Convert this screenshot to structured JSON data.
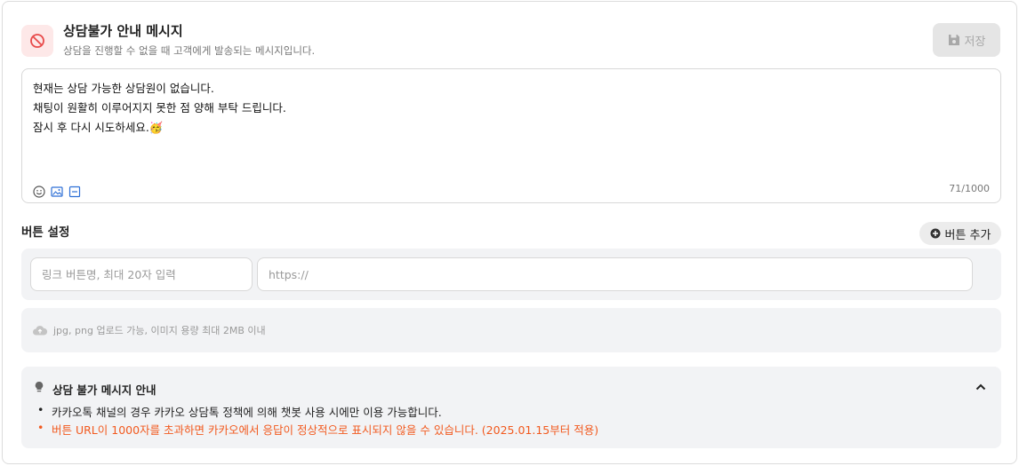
{
  "header": {
    "title": "상담불가 안내 메시지",
    "subtitle": "상담을 진행할 수 없을 때 고객에게 발송되는 메시지입니다.",
    "save_label": "저장"
  },
  "message": {
    "lines": [
      "현재는 상담 가능한 상담원이 없습니다.",
      "채팅이 원활히 이루어지지 못한 점 양해 부탁 드립니다.",
      "잠시 후 다시 시도하세요.🥳"
    ],
    "counter": "71/1000",
    "tools": [
      "emoji-icon",
      "image-icon",
      "template-icon"
    ]
  },
  "buttons": {
    "section_title": "버튼 설정",
    "add_label": "버튼 추가",
    "name_placeholder": "링크 버튼명, 최대 20자 입력",
    "url_placeholder": "https://"
  },
  "upload": {
    "hint": "jpg, png 업로드 가능, 이미지 용량 최대 2MB 이내"
  },
  "notice": {
    "title": "상담 불가 메시지 안내",
    "items": [
      "카카오톡 채널의 경우 카카오 상담톡 정책에 의해 챗봇 사용 시에만 이용 가능합니다.",
      "버튼 URL이 1000자를 초과하면 카카오에서 응답이 정상적으로 표시되지 않을 수 있습니다. (2025.01.15부터 적용)"
    ]
  },
  "colors": {
    "accent_red": "#e84a4a",
    "warning": "#f25a1f"
  }
}
